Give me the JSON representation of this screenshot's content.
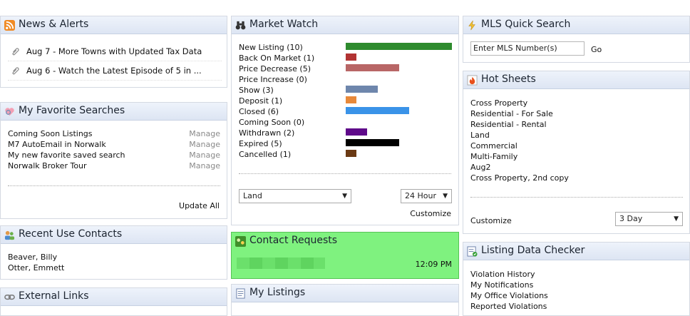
{
  "news": {
    "title": "News & Alerts",
    "items": [
      {
        "text": "Aug 7 - More Towns with Updated Tax Data"
      },
      {
        "text": "Aug 6 - Watch the Latest Episode of 5 in ..."
      }
    ]
  },
  "favorites": {
    "title": "My Favorite Searches",
    "items": [
      {
        "label": "Coming Soon Listings",
        "action": "Manage"
      },
      {
        "label": "M7 AutoEmail in Norwalk",
        "action": "Manage"
      },
      {
        "label": "My new favorite saved search",
        "action": "Manage"
      },
      {
        "label": "Norwalk Broker Tour",
        "action": "Manage"
      }
    ],
    "update_all": "Update All"
  },
  "contacts": {
    "title": "Recent Use Contacts",
    "items": [
      "Beaver, Billy",
      "Otter, Emmett"
    ]
  },
  "external": {
    "title": "External Links"
  },
  "market": {
    "title": "Market Watch",
    "rows": [
      {
        "label": "New Listing (10)",
        "value": 10,
        "color": "#2e8b2e"
      },
      {
        "label": "Back On Market (1)",
        "value": 1,
        "color": "#b23333"
      },
      {
        "label": "Price Decrease (5)",
        "value": 5,
        "color": "#b86666"
      },
      {
        "label": "Price Increase (0)",
        "value": 0,
        "color": "#2e8b2e"
      },
      {
        "label": "Show (3)",
        "value": 3,
        "color": "#6e86ac"
      },
      {
        "label": "Deposit (1)",
        "value": 1,
        "color": "#e8893a"
      },
      {
        "label": "Closed (6)",
        "value": 6,
        "color": "#3a93e8"
      },
      {
        "label": "Coming Soon (0)",
        "value": 0,
        "color": "#2e8b2e"
      },
      {
        "label": "Withdrawn (2)",
        "value": 2,
        "color": "#5f0a8a"
      },
      {
        "label": "Expired (5)",
        "value": 5,
        "color": "#000000"
      },
      {
        "label": "Cancelled (1)",
        "value": 1,
        "color": "#6b3a14"
      }
    ],
    "max": 10,
    "type_select": "Land",
    "period_select": "24 Hour",
    "customize": "Customize"
  },
  "contact_requests": {
    "title": "Contact Requests",
    "time": "12:09 PM",
    "accent": "#7ff27f"
  },
  "my_listings": {
    "title": "My Listings"
  },
  "mls": {
    "title": "MLS Quick Search",
    "placeholder": "Enter MLS Number(s)",
    "go": "Go"
  },
  "hot_sheets": {
    "title": "Hot Sheets",
    "items": [
      "Cross Property",
      "Residential - For Sale",
      "Residential - Rental",
      "Land",
      "Commercial",
      "Multi-Family",
      "Aug2",
      "Cross Property, 2nd copy"
    ],
    "customize": "Customize",
    "period_select": "3 Day"
  },
  "checker": {
    "title": "Listing Data Checker",
    "items": [
      "Violation History",
      "My Notifications",
      "My Office Violations",
      "Reported Violations"
    ]
  }
}
